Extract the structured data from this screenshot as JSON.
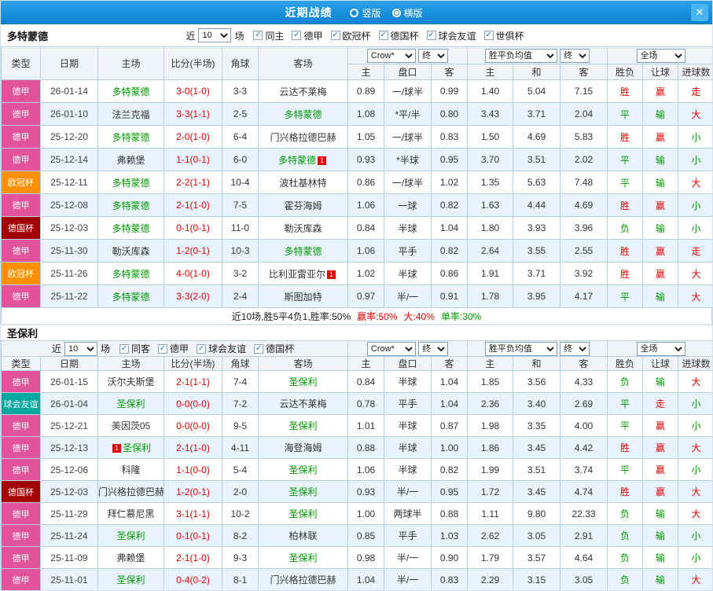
{
  "topbar": {
    "title": "近期战绩",
    "radios": [
      {
        "label": "竖版",
        "selected": false
      },
      {
        "label": "横版",
        "selected": true
      }
    ],
    "close_icon": "✕"
  },
  "col_headers": {
    "type": "类型",
    "date": "日期",
    "home": "主场",
    "score": "比分(半场)",
    "corner": "角球",
    "away": "客场",
    "asia_home": "主",
    "asia_line": "盘口",
    "asia_away": "客",
    "eu_home": "主",
    "eu_draw": "和",
    "eu_away": "客",
    "wdl": "胜负",
    "handicap": "让球",
    "goals": "进球数"
  },
  "selects": {
    "company": "Crow*",
    "final": "终",
    "wdl_avg": "胜平负均值",
    "scope": "全场"
  },
  "badge_text": "1",
  "league_colors": {
    "德甲": "#e2539b",
    "欧冠杯": "#ff9000",
    "德国杯": "#a40000",
    "球会友谊": "#00a89e"
  },
  "sections": [
    {
      "team": "多特蒙德",
      "filters": {
        "near": "近",
        "count": "10",
        "games": "场",
        "checks": [
          {
            "label": "同主",
            "checked": true
          },
          {
            "label": "德甲",
            "checked": true
          },
          {
            "label": "欧冠杯",
            "checked": true
          },
          {
            "label": "德国杯",
            "checked": true
          },
          {
            "label": "球会友谊",
            "checked": true
          },
          {
            "label": "世俱杯",
            "checked": true
          }
        ]
      },
      "rows": [
        {
          "league": "德甲",
          "date": "26-01-14",
          "home": "多特蒙德",
          "home_hl": true,
          "score": "3-0(1-0)",
          "corner": "3-3",
          "away": "云达不莱梅",
          "away_hl": false,
          "a1": "0.89",
          "line": "一/球半",
          "a2": "0.99",
          "e1": "1.40",
          "e2": "5.04",
          "e3": "7.15",
          "r1": "胜",
          "c1": "r",
          "r2": "赢",
          "c2": "r",
          "r3": "走",
          "c3": "r"
        },
        {
          "league": "德甲",
          "date": "26-01-10",
          "home": "法兰克福",
          "home_hl": false,
          "score": "3-3(1-1)",
          "corner": "2-5",
          "away": "多特蒙德",
          "away_hl": true,
          "a1": "1.08",
          "line": "*平/半",
          "a2": "0.80",
          "e1": "3.43",
          "e2": "3.71",
          "e3": "2.04",
          "r1": "平",
          "c1": "g",
          "r2": "输",
          "c2": "g",
          "r3": "大",
          "c3": "r"
        },
        {
          "league": "德甲",
          "date": "25-12-20",
          "home": "多特蒙德",
          "home_hl": true,
          "score": "2-0(1-0)",
          "corner": "6-4",
          "away": "门兴格拉德巴赫",
          "away_hl": false,
          "a1": "1.05",
          "line": "一/球半",
          "a2": "0.83",
          "e1": "1.50",
          "e2": "4.69",
          "e3": "5.83",
          "r1": "胜",
          "c1": "r",
          "r2": "赢",
          "c2": "r",
          "r3": "小",
          "c3": "g"
        },
        {
          "league": "德甲",
          "date": "25-12-14",
          "home": "弗赖堡",
          "home_hl": false,
          "score": "1-1(0-1)",
          "corner": "6-0",
          "away": "多特蒙德",
          "away_hl": true,
          "away_badge": "after",
          "a1": "0.93",
          "line": "*半球",
          "a2": "0.95",
          "e1": "3.70",
          "e2": "3.51",
          "e3": "2.02",
          "r1": "平",
          "c1": "g",
          "r2": "输",
          "c2": "g",
          "r3": "小",
          "c3": "g"
        },
        {
          "league": "欧冠杯",
          "date": "25-12-11",
          "home": "多特蒙德",
          "home_hl": true,
          "score": "2-2(1-1)",
          "corner": "10-4",
          "away": "波杜基林特",
          "away_hl": false,
          "a1": "0.86",
          "line": "一/球半",
          "a2": "1.02",
          "e1": "1.35",
          "e2": "5.63",
          "e3": "7.48",
          "r1": "平",
          "c1": "g",
          "r2": "输",
          "c2": "g",
          "r3": "大",
          "c3": "r"
        },
        {
          "league": "德甲",
          "date": "25-12-08",
          "home": "多特蒙德",
          "home_hl": true,
          "score": "2-1(1-0)",
          "corner": "7-5",
          "away": "霍芬海姆",
          "away_hl": false,
          "a1": "1.06",
          "line": "一球",
          "a2": "0.82",
          "e1": "1.63",
          "e2": "4.44",
          "e3": "4.69",
          "r1": "胜",
          "c1": "r",
          "r2": "赢",
          "c2": "r",
          "r3": "小",
          "c3": "g"
        },
        {
          "league": "德国杯",
          "date": "25-12-03",
          "home": "多特蒙德",
          "home_hl": true,
          "score": "0-1(0-1)",
          "corner": "11-0",
          "away": "勒沃库森",
          "away_hl": false,
          "a1": "0.84",
          "line": "半球",
          "a2": "1.04",
          "e1": "1.80",
          "e2": "3.93",
          "e3": "3.96",
          "r1": "负",
          "c1": "g",
          "r2": "输",
          "c2": "g",
          "r3": "小",
          "c3": "g"
        },
        {
          "league": "德甲",
          "date": "25-11-30",
          "home": "勒沃库森",
          "home_hl": false,
          "score": "1-2(0-1)",
          "corner": "10-3",
          "away": "多特蒙德",
          "away_hl": true,
          "a1": "1.06",
          "line": "平手",
          "a2": "0.82",
          "e1": "2.64",
          "e2": "3.55",
          "e3": "2.55",
          "r1": "胜",
          "c1": "r",
          "r2": "赢",
          "c2": "r",
          "r3": "走",
          "c3": "r"
        },
        {
          "league": "欧冠杯",
          "date": "25-11-26",
          "home": "多特蒙德",
          "home_hl": true,
          "score": "4-0(1-0)",
          "corner": "3-2",
          "away": "比利亚雷亚尔",
          "away_hl": false,
          "away_badge": "after",
          "a1": "1.02",
          "line": "半球",
          "a2": "0.86",
          "e1": "1.91",
          "e2": "3.71",
          "e3": "3.92",
          "r1": "胜",
          "c1": "r",
          "r2": "赢",
          "c2": "r",
          "r3": "大",
          "c3": "r"
        },
        {
          "league": "德甲",
          "date": "25-11-22",
          "home": "多特蒙德",
          "home_hl": true,
          "score": "3-3(2-0)",
          "corner": "2-4",
          "away": "斯图加特",
          "away_hl": false,
          "a1": "0.97",
          "line": "半/一",
          "a2": "0.91",
          "e1": "1.78",
          "e2": "3.95",
          "e3": "4.17",
          "r1": "平",
          "c1": "g",
          "r2": "输",
          "c2": "g",
          "r3": "大",
          "c3": "r"
        }
      ],
      "summary": [
        "近10场,胜5平4负1,胜率:50%",
        "赢率:50%",
        "大:40%",
        "单率:30%"
      ]
    },
    {
      "team": "圣保利",
      "filters": {
        "near": "近",
        "count": "10",
        "games": "场",
        "checks": [
          {
            "label": "同客",
            "checked": true
          },
          {
            "label": "德甲",
            "checked": true
          },
          {
            "label": "球会友谊",
            "checked": true
          },
          {
            "label": "德国杯",
            "checked": true
          }
        ]
      },
      "rows": [
        {
          "league": "德甲",
          "date": "26-01-15",
          "home": "沃尔夫斯堡",
          "home_hl": false,
          "score": "2-1(1-1)",
          "corner": "7-4",
          "away": "圣保利",
          "away_hl": true,
          "a1": "0.84",
          "line": "半球",
          "a2": "1.04",
          "e1": "1.85",
          "e2": "3.56",
          "e3": "4.33",
          "r1": "负",
          "c1": "g",
          "r2": "输",
          "c2": "g",
          "r3": "大",
          "c3": "r"
        },
        {
          "league": "球会友谊",
          "date": "26-01-04",
          "home": "圣保利",
          "home_hl": true,
          "score": "0-0(0-0)",
          "corner": "7-2",
          "away": "云达不莱梅",
          "away_hl": false,
          "a1": "0.78",
          "line": "平手",
          "a2": "1.04",
          "e1": "2.36",
          "e2": "3.40",
          "e3": "2.69",
          "r1": "平",
          "c1": "g",
          "r2": "走",
          "c2": "r",
          "r3": "小",
          "c3": "g"
        },
        {
          "league": "德甲",
          "date": "25-12-21",
          "home": "美因茨05",
          "home_hl": false,
          "score": "0-0(0-0)",
          "corner": "9-5",
          "away": "圣保利",
          "away_hl": true,
          "a1": "1.01",
          "line": "半球",
          "a2": "0.87",
          "e1": "1.98",
          "e2": "3.35",
          "e3": "4.00",
          "r1": "平",
          "c1": "g",
          "r2": "赢",
          "c2": "r",
          "r3": "小",
          "c3": "g"
        },
        {
          "league": "德甲",
          "date": "25-12-13",
          "home": "圣保利",
          "home_hl": true,
          "home_badge": "before",
          "score": "2-1(1-0)",
          "corner": "4-11",
          "away": "海登海姆",
          "away_hl": false,
          "a1": "0.88",
          "line": "半球",
          "a2": "1.00",
          "e1": "1.86",
          "e2": "3.45",
          "e3": "4.42",
          "r1": "胜",
          "c1": "r",
          "r2": "赢",
          "c2": "r",
          "r3": "大",
          "c3": "r"
        },
        {
          "league": "德甲",
          "date": "25-12-06",
          "home": "科隆",
          "home_hl": false,
          "score": "1-1(0-0)",
          "corner": "5-4",
          "away": "圣保利",
          "away_hl": true,
          "a1": "1.06",
          "line": "半球",
          "a2": "0.82",
          "e1": "1.99",
          "e2": "3.51",
          "e3": "3.74",
          "r1": "平",
          "c1": "g",
          "r2": "赢",
          "c2": "r",
          "r3": "小",
          "c3": "g"
        },
        {
          "league": "德国杯",
          "date": "25-12-03",
          "home": "门兴格拉德巴赫",
          "home_hl": false,
          "score": "1-2(0-1)",
          "corner": "2-0",
          "away": "圣保利",
          "away_hl": true,
          "a1": "0.93",
          "line": "半/一",
          "a2": "0.95",
          "e1": "1.72",
          "e2": "3.45",
          "e3": "4.74",
          "r1": "胜",
          "c1": "r",
          "r2": "赢",
          "c2": "r",
          "r3": "大",
          "c3": "r"
        },
        {
          "league": "德甲",
          "date": "25-11-29",
          "home": "拜仁慕尼黑",
          "home_hl": false,
          "score": "3-1(1-1)",
          "corner": "10-2",
          "away": "圣保利",
          "away_hl": true,
          "a1": "1.00",
          "line": "两球半",
          "a2": "0.88",
          "e1": "1.11",
          "e2": "9.80",
          "e3": "22.33",
          "r1": "负",
          "c1": "g",
          "r2": "输",
          "c2": "g",
          "r3": "大",
          "c3": "r"
        },
        {
          "league": "德甲",
          "date": "25-11-24",
          "home": "圣保利",
          "home_hl": true,
          "score": "0-1(0-1)",
          "corner": "8-2",
          "away": "柏林联",
          "away_hl": false,
          "a1": "0.85",
          "line": "平手",
          "a2": "1.03",
          "e1": "2.62",
          "e2": "3.05",
          "e3": "2.91",
          "r1": "负",
          "c1": "g",
          "r2": "输",
          "c2": "g",
          "r3": "小",
          "c3": "g"
        },
        {
          "league": "德甲",
          "date": "25-11-09",
          "home": "弗赖堡",
          "home_hl": false,
          "score": "2-1(1-0)",
          "corner": "9-3",
          "away": "圣保利",
          "away_hl": true,
          "a1": "0.98",
          "line": "半/一",
          "a2": "0.90",
          "e1": "1.79",
          "e2": "3.57",
          "e3": "4.64",
          "r1": "负",
          "c1": "g",
          "r2": "输",
          "c2": "g",
          "r3": "小",
          "c3": "g"
        },
        {
          "league": "德甲",
          "date": "25-11-01",
          "home": "圣保利",
          "home_hl": true,
          "score": "0-4(0-2)",
          "corner": "8-1",
          "away": "门兴格拉德巴赫",
          "away_hl": false,
          "a1": "1.04",
          "line": "半/一",
          "a2": "0.83",
          "e1": "2.29",
          "e2": "3.15",
          "e3": "3.05",
          "r1": "负",
          "c1": "g",
          "r2": "输",
          "c2": "g",
          "r3": "大",
          "c3": "r"
        }
      ]
    }
  ]
}
